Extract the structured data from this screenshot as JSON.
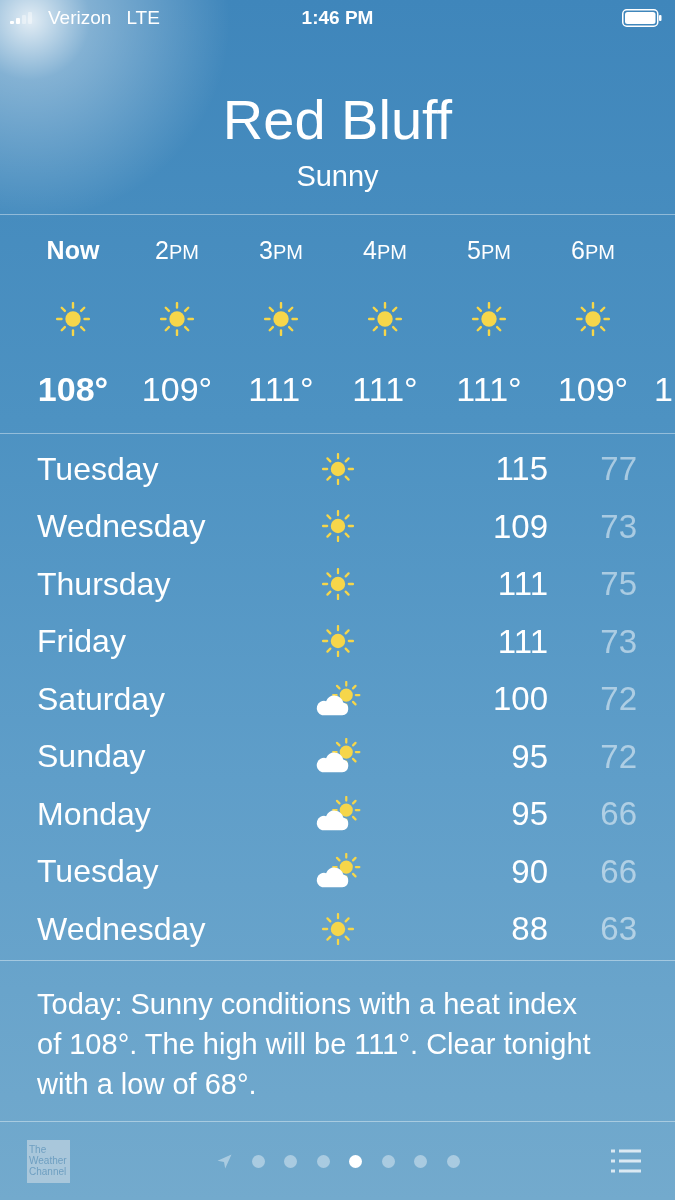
{
  "status_bar": {
    "carrier": "Verizon",
    "network": "LTE",
    "time": "1:46 PM"
  },
  "location": {
    "city": "Red Bluff",
    "condition": "Sunny"
  },
  "hourly": [
    {
      "kind": "sunny",
      "selected": true,
      "label": "Now",
      "temp": "108°"
    },
    {
      "kind": "sunny",
      "selected": false,
      "label": "2",
      "period": "PM",
      "temp": "109°"
    },
    {
      "kind": "sunny",
      "selected": false,
      "label": "3",
      "period": "PM",
      "temp": "111°"
    },
    {
      "kind": "sunny",
      "selected": false,
      "label": "4",
      "period": "PM",
      "temp": "111°"
    },
    {
      "kind": "sunny",
      "selected": false,
      "label": "5",
      "period": "PM",
      "temp": "111°"
    },
    {
      "kind": "sunny",
      "selected": false,
      "label": "6",
      "period": "PM",
      "temp": "109°"
    },
    {
      "kind": "partial",
      "selected": false,
      "temp": "1"
    }
  ],
  "daily": [
    {
      "day": "Tuesday",
      "kind": "sunny",
      "high": "115",
      "low": "77"
    },
    {
      "day": "Wednesday",
      "kind": "sunny",
      "high": "109",
      "low": "73"
    },
    {
      "day": "Thursday",
      "kind": "sunny",
      "high": "111",
      "low": "75"
    },
    {
      "day": "Friday",
      "kind": "sunny",
      "high": "111",
      "low": "73"
    },
    {
      "day": "Saturday",
      "kind": "partly_cloudy",
      "high": "100",
      "low": "72"
    },
    {
      "day": "Sunday",
      "kind": "partly_cloudy",
      "high": "95",
      "low": "72"
    },
    {
      "day": "Monday",
      "kind": "partly_cloudy",
      "high": "95",
      "low": "66"
    },
    {
      "day": "Tuesday",
      "kind": "partly_cloudy",
      "high": "90",
      "low": "66"
    },
    {
      "day": "Wednesday",
      "kind": "sunny",
      "high": "88",
      "low": "63"
    }
  ],
  "summary": "Today: Sunny conditions with a heat index of 108°. The high will be 111°. Clear tonight with a low of 68°.",
  "bottom_bar": {
    "logo_lines": [
      "The",
      "Weather",
      "Channel"
    ],
    "pages": [
      {
        "kind": "location",
        "selected": false
      },
      {
        "kind": "city",
        "selected": false
      },
      {
        "kind": "city",
        "selected": false
      },
      {
        "kind": "city",
        "selected": false
      },
      {
        "kind": "city",
        "selected": true
      },
      {
        "kind": "city",
        "selected": false
      },
      {
        "kind": "city",
        "selected": false
      },
      {
        "kind": "city",
        "selected": false
      }
    ]
  }
}
